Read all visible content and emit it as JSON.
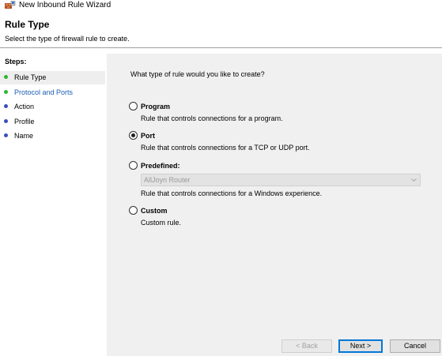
{
  "window": {
    "title": "New Inbound Rule Wizard",
    "icon": "firewall-wizard-icon"
  },
  "header": {
    "title": "Rule Type",
    "subtitle": "Select the type of firewall rule to create."
  },
  "sidebar": {
    "title": "Steps:",
    "items": [
      {
        "label": "Rule Type",
        "state": "current",
        "dot_color": "#2fb52f"
      },
      {
        "label": "Protocol and Ports",
        "state": "link",
        "dot_color": "#2fb52f"
      },
      {
        "label": "Action",
        "state": "upcoming",
        "dot_color": "#3b4fb8"
      },
      {
        "label": "Profile",
        "state": "upcoming",
        "dot_color": "#3b4fb8"
      },
      {
        "label": "Name",
        "state": "upcoming",
        "dot_color": "#3b4fb8"
      }
    ]
  },
  "main": {
    "question": "What type of rule would you like to create?",
    "options": [
      {
        "label": "Program",
        "description": "Rule that controls connections for a program.",
        "selected": false
      },
      {
        "label": "Port",
        "description": "Rule that controls connections for a TCP or UDP port.",
        "selected": true
      },
      {
        "label": "Predefined:",
        "description": "Rule that controls connections for a Windows experience.",
        "selected": false
      },
      {
        "label": "Custom",
        "description": "Custom rule.",
        "selected": false
      }
    ],
    "predefined_select": {
      "value": "AllJoyn Router",
      "enabled": false
    }
  },
  "footer": {
    "back_label": "< Back",
    "next_label": "Next >",
    "cancel_label": "Cancel"
  }
}
